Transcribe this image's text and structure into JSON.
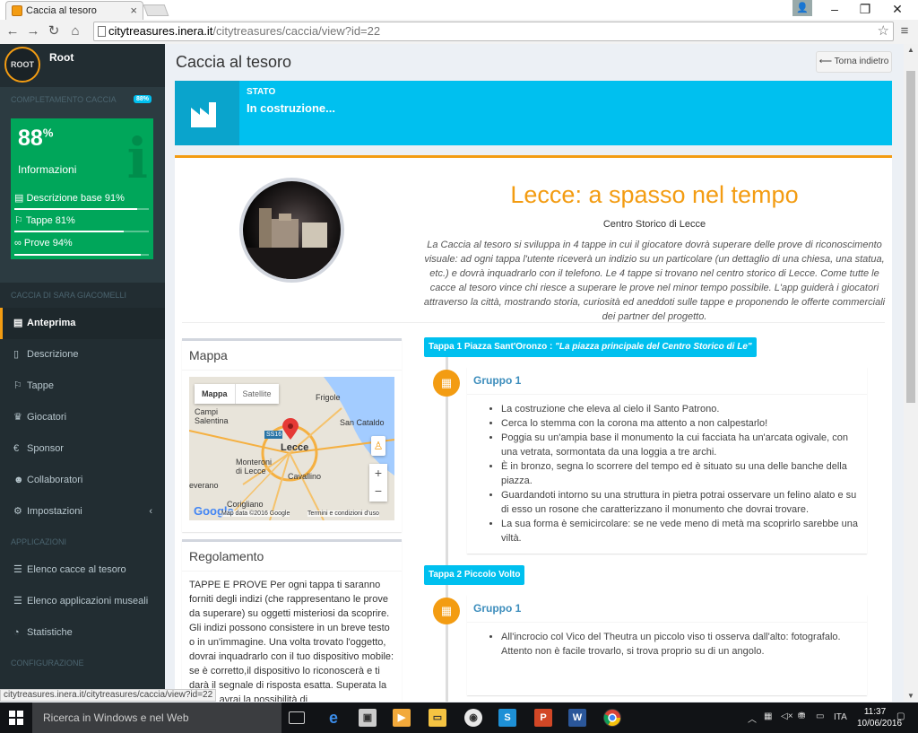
{
  "browser": {
    "tab_title": "Caccia al tesoro",
    "url_host": "citytreasures.inera.it",
    "url_path": "/citytreasures/caccia/view?id=22",
    "status_url": "citytreasures.inera.it/citytreasures/caccia/view?id=22"
  },
  "sidebar": {
    "user_logo": "ROOT",
    "user_name": "Root",
    "progress_header": "COMPLETAMENTO CACCIA",
    "progress_badge": "88%",
    "progress_big": "88",
    "progress_big_unit": "%",
    "progress_info": "Informazioni",
    "stats": [
      {
        "label": "Descrizione base 91%",
        "value": 91
      },
      {
        "label": "Tappe 81%",
        "value": 81
      },
      {
        "label": "Prove 94%",
        "value": 94
      }
    ],
    "section_hunt": "CACCIA DI SARA GIACOMELLI",
    "menu": [
      {
        "label": "Anteprima"
      },
      {
        "label": "Descrizione"
      },
      {
        "label": "Tappe"
      },
      {
        "label": "Giocatori"
      },
      {
        "label": "Sponsor"
      },
      {
        "label": "Collaboratori"
      },
      {
        "label": "Impostazioni"
      }
    ],
    "section_apps": "APPLICAZIONI",
    "apps": [
      {
        "label": "Elenco cacce al tesoro"
      },
      {
        "label": "Elenco applicazioni museali"
      },
      {
        "label": "Statistiche"
      }
    ],
    "section_config": "CONFIGURAZIONE"
  },
  "main": {
    "page_title": "Caccia al tesoro",
    "back_button": "⟵ Torna indietro",
    "status_label": "STATO",
    "status_value": "In costruzione...",
    "hunt_title": "Lecce: a spasso nel tempo",
    "hunt_subtitle": "Centro Storico di Lecce",
    "hunt_description": "La Caccia al tesoro si sviluppa in 4 tappe in cui il giocatore dovrà superare delle prove di riconoscimento visuale: ad ogni tappa l'utente riceverà un indizio su un particolare (un dettaglio di una chiesa, una statua, etc.) e dovrà inquadrarlo con il telefono. Le 4 tappe si trovano nel centro storico di Lecce. Come tutte le cacce al tesoro vince chi riesce a superare le prove nel minor tempo possibile. L'app guiderà i giocatori attraverso la città, mostrando storia, curiosità ed aneddoti sulle tappe e proponendo le offerte commerciali dei partner del progetto.",
    "map_title": "Mappa",
    "map": {
      "btn_map": "Mappa",
      "btn_sat": "Satellite",
      "labels": [
        "Frigole",
        "Campi Salentina",
        "San Cataldo",
        "SS16",
        "Lecce",
        "Monteroni di Lecce",
        "Cavallino",
        "everano",
        "Corigliano"
      ],
      "footer_data": "Map data ©2016 Google",
      "footer_terms": "Termini e condizioni d'uso",
      "google": "Google"
    },
    "rules_title": "Regolamento",
    "rules_text": "TAPPE E PROVE Per ogni tappa ti saranno forniti degli indizi (che rappresentano le prove da superare) su oggetti misteriosi da scoprire. Gli indizi possono consistere in un breve testo o in un'immagine. Una volta trovato l'oggetto, dovrai inquadrarlo con il tuo dispositivo mobile: se è corretto,il dispositivo lo riconoscerà e ti darà il segnale di risposta esatta. Superata la prova, avrai la possibilità di",
    "tappe": [
      {
        "title": "Tappa 1 Piazza Sant'Oronzo : ",
        "quote": "\"La piazza principale del Centro Storico di Le\"",
        "group": "Gruppo 1",
        "clues": [
          "La costruzione che eleva al cielo il Santo Patrono.",
          "Cerca lo stemma con la corona ma attento a non calpestarlo!",
          "Poggia su un'ampia base il monumento la cui facciata ha un'arcata ogivale, con una vetrata, sormontata da una loggia a tre archi.",
          "È in bronzo, segna lo scorrere del tempo ed è situato su una delle banche della piazza.",
          "Guardandoti intorno su una struttura in pietra potrai osservare un felino alato e su di esso un rosone che caratterizzano il monumento che dovrai trovare.",
          "La sua forma è semicircolare: se ne vede meno di metà ma scoprirlo sarebbe una viltà."
        ]
      },
      {
        "title": "Tappa 2 Piccolo Volto",
        "quote": "",
        "group": "Gruppo 1",
        "clues": [
          "All'incrocio col Vico del Theutra un piccolo viso ti osserva dall'alto: fotografalo. Attento non è facile trovarlo, si trova proprio su di un angolo."
        ]
      }
    ]
  },
  "taskbar": {
    "search_placeholder": "Ricerca in Windows e nel Web",
    "lang": "ITA",
    "time": "11:37",
    "date": "10/06/2016"
  }
}
